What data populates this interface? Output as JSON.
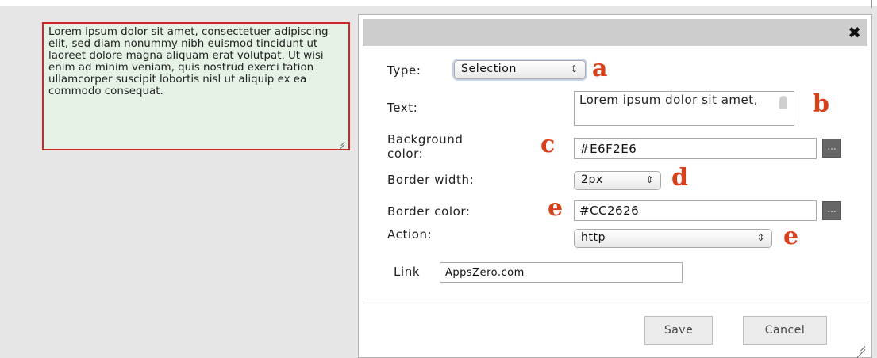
{
  "note": {
    "text": "Lorem ipsum dolor sit amet, consectetuer adipiscing elit, sed diam nonummy nibh euismod tincidunt ut laoreet dolore magna aliquam erat volutpat. Ut wisi enim ad minim veniam, quis nostrud exerci tation ullamcorper suscipit lobortis nisl ut aliquip ex ea commodo consequat.",
    "background_color": "#E6F2E6",
    "border_color": "#CC2626"
  },
  "dialog": {
    "close_glyph": "✖",
    "type": {
      "label": "Type:",
      "value": "Selection",
      "marker": "a"
    },
    "text": {
      "label": "Text:",
      "value": "Lorem ipsum dolor sit amet,",
      "marker": "b"
    },
    "background_color": {
      "label_line1": "Background",
      "label_line2": "color:",
      "value": "#E6F2E6",
      "marker": "c",
      "picker_label": "..."
    },
    "border_width": {
      "label": "Border width:",
      "value": "2px",
      "marker": "d"
    },
    "border_color": {
      "label": "Border color:",
      "value": "#CC2626",
      "marker": "e",
      "picker_label": "..."
    },
    "action": {
      "label": "Action:",
      "value": "http",
      "marker": "e"
    },
    "link": {
      "label": "Link",
      "value": "AppsZero.com"
    },
    "buttons": {
      "save": "Save",
      "cancel": "Cancel"
    }
  },
  "colors": {
    "marker": "#d9401a",
    "titlebar": "#cdcdcd",
    "page_background": "#e6e6e6"
  }
}
